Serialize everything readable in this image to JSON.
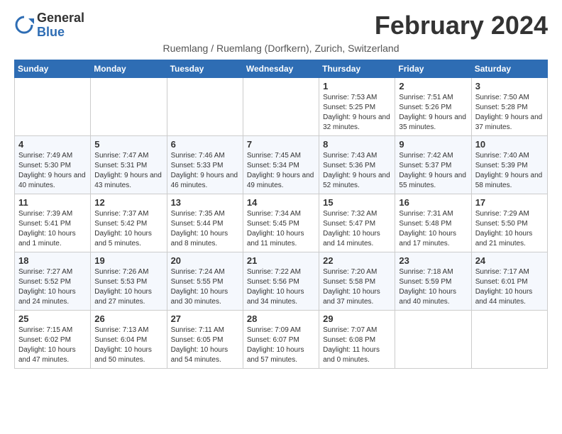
{
  "header": {
    "logo_general": "General",
    "logo_blue": "Blue",
    "month_year": "February 2024",
    "subtitle": "Ruemlang / Ruemlang (Dorfkern), Zurich, Switzerland"
  },
  "weekdays": [
    "Sunday",
    "Monday",
    "Tuesday",
    "Wednesday",
    "Thursday",
    "Friday",
    "Saturday"
  ],
  "weeks": [
    [
      {
        "day": "",
        "info": ""
      },
      {
        "day": "",
        "info": ""
      },
      {
        "day": "",
        "info": ""
      },
      {
        "day": "",
        "info": ""
      },
      {
        "day": "1",
        "info": "Sunrise: 7:53 AM\nSunset: 5:25 PM\nDaylight: 9 hours\nand 32 minutes."
      },
      {
        "day": "2",
        "info": "Sunrise: 7:51 AM\nSunset: 5:26 PM\nDaylight: 9 hours\nand 35 minutes."
      },
      {
        "day": "3",
        "info": "Sunrise: 7:50 AM\nSunset: 5:28 PM\nDaylight: 9 hours\nand 37 minutes."
      }
    ],
    [
      {
        "day": "4",
        "info": "Sunrise: 7:49 AM\nSunset: 5:30 PM\nDaylight: 9 hours\nand 40 minutes."
      },
      {
        "day": "5",
        "info": "Sunrise: 7:47 AM\nSunset: 5:31 PM\nDaylight: 9 hours\nand 43 minutes."
      },
      {
        "day": "6",
        "info": "Sunrise: 7:46 AM\nSunset: 5:33 PM\nDaylight: 9 hours\nand 46 minutes."
      },
      {
        "day": "7",
        "info": "Sunrise: 7:45 AM\nSunset: 5:34 PM\nDaylight: 9 hours\nand 49 minutes."
      },
      {
        "day": "8",
        "info": "Sunrise: 7:43 AM\nSunset: 5:36 PM\nDaylight: 9 hours\nand 52 minutes."
      },
      {
        "day": "9",
        "info": "Sunrise: 7:42 AM\nSunset: 5:37 PM\nDaylight: 9 hours\nand 55 minutes."
      },
      {
        "day": "10",
        "info": "Sunrise: 7:40 AM\nSunset: 5:39 PM\nDaylight: 9 hours\nand 58 minutes."
      }
    ],
    [
      {
        "day": "11",
        "info": "Sunrise: 7:39 AM\nSunset: 5:41 PM\nDaylight: 10 hours\nand 1 minute."
      },
      {
        "day": "12",
        "info": "Sunrise: 7:37 AM\nSunset: 5:42 PM\nDaylight: 10 hours\nand 5 minutes."
      },
      {
        "day": "13",
        "info": "Sunrise: 7:35 AM\nSunset: 5:44 PM\nDaylight: 10 hours\nand 8 minutes."
      },
      {
        "day": "14",
        "info": "Sunrise: 7:34 AM\nSunset: 5:45 PM\nDaylight: 10 hours\nand 11 minutes."
      },
      {
        "day": "15",
        "info": "Sunrise: 7:32 AM\nSunset: 5:47 PM\nDaylight: 10 hours\nand 14 minutes."
      },
      {
        "day": "16",
        "info": "Sunrise: 7:31 AM\nSunset: 5:48 PM\nDaylight: 10 hours\nand 17 minutes."
      },
      {
        "day": "17",
        "info": "Sunrise: 7:29 AM\nSunset: 5:50 PM\nDaylight: 10 hours\nand 21 minutes."
      }
    ],
    [
      {
        "day": "18",
        "info": "Sunrise: 7:27 AM\nSunset: 5:52 PM\nDaylight: 10 hours\nand 24 minutes."
      },
      {
        "day": "19",
        "info": "Sunrise: 7:26 AM\nSunset: 5:53 PM\nDaylight: 10 hours\nand 27 minutes."
      },
      {
        "day": "20",
        "info": "Sunrise: 7:24 AM\nSunset: 5:55 PM\nDaylight: 10 hours\nand 30 minutes."
      },
      {
        "day": "21",
        "info": "Sunrise: 7:22 AM\nSunset: 5:56 PM\nDaylight: 10 hours\nand 34 minutes."
      },
      {
        "day": "22",
        "info": "Sunrise: 7:20 AM\nSunset: 5:58 PM\nDaylight: 10 hours\nand 37 minutes."
      },
      {
        "day": "23",
        "info": "Sunrise: 7:18 AM\nSunset: 5:59 PM\nDaylight: 10 hours\nand 40 minutes."
      },
      {
        "day": "24",
        "info": "Sunrise: 7:17 AM\nSunset: 6:01 PM\nDaylight: 10 hours\nand 44 minutes."
      }
    ],
    [
      {
        "day": "25",
        "info": "Sunrise: 7:15 AM\nSunset: 6:02 PM\nDaylight: 10 hours\nand 47 minutes."
      },
      {
        "day": "26",
        "info": "Sunrise: 7:13 AM\nSunset: 6:04 PM\nDaylight: 10 hours\nand 50 minutes."
      },
      {
        "day": "27",
        "info": "Sunrise: 7:11 AM\nSunset: 6:05 PM\nDaylight: 10 hours\nand 54 minutes."
      },
      {
        "day": "28",
        "info": "Sunrise: 7:09 AM\nSunset: 6:07 PM\nDaylight: 10 hours\nand 57 minutes."
      },
      {
        "day": "29",
        "info": "Sunrise: 7:07 AM\nSunset: 6:08 PM\nDaylight: 11 hours\nand 0 minutes."
      },
      {
        "day": "",
        "info": ""
      },
      {
        "day": "",
        "info": ""
      }
    ]
  ]
}
